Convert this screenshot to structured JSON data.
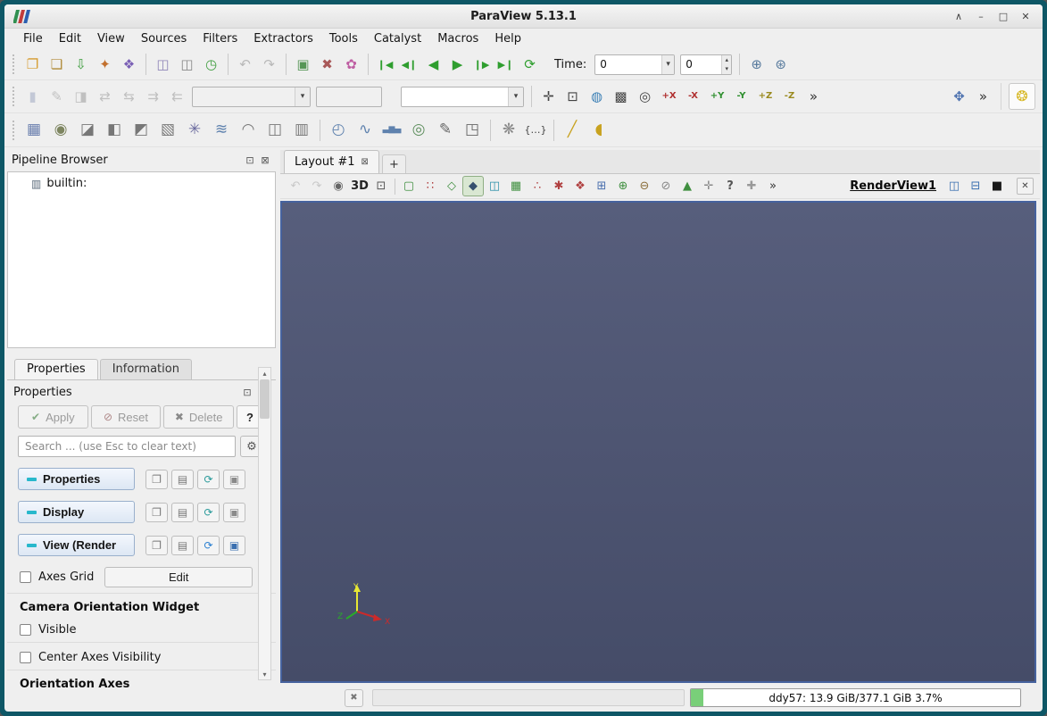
{
  "window": {
    "title": "ParaView 5.13.1",
    "controls": [
      {
        "name": "shade-window-button",
        "glyph": "∧",
        "color": "#444"
      },
      {
        "name": "minimize-window-button",
        "glyph": "–",
        "color": "#444"
      },
      {
        "name": "maximize-window-button",
        "glyph": "□",
        "color": "#444"
      },
      {
        "name": "close-window-button",
        "glyph": "✕",
        "color": "#444"
      }
    ]
  },
  "menu": {
    "items": [
      "File",
      "Edit",
      "View",
      "Sources",
      "Filters",
      "Extractors",
      "Tools",
      "Catalyst",
      "Macros",
      "Help"
    ]
  },
  "toolbar1": {
    "icons": [
      {
        "grip": true
      },
      {
        "name": "open-file-icon",
        "glyph": "❐",
        "color": "#d59b2e"
      },
      {
        "name": "save-state-icon",
        "glyph": "❏",
        "color": "#b08a36"
      },
      {
        "name": "save-data-icon",
        "glyph": "⇩",
        "color": "#3f9e3f"
      },
      {
        "name": "save-screenshot-icon",
        "glyph": "✦",
        "color": "#c2702e"
      },
      {
        "name": "save-animation-icon",
        "glyph": "❖",
        "color": "#7a5fb5"
      },
      {
        "sep": true
      },
      {
        "name": "catalyst-connect-icon",
        "glyph": "◫",
        "color": "#8f86b8"
      },
      {
        "name": "catalyst-export-icon",
        "glyph": "◫",
        "color": "#888888"
      },
      {
        "name": "timer-log-icon",
        "glyph": "◷",
        "color": "#3f9e3f"
      },
      {
        "sep": true
      },
      {
        "name": "undo-icon",
        "glyph": "↶",
        "color": "#777777",
        "disabled": true
      },
      {
        "name": "redo-icon",
        "glyph": "↷",
        "color": "#777777",
        "disabled": true
      },
      {
        "sep": true
      },
      {
        "name": "load-state-icon",
        "glyph": "▣",
        "color": "#579657"
      },
      {
        "name": "reset-session-icon",
        "glyph": "✖",
        "color": "#a85858"
      },
      {
        "name": "color-palette-icon",
        "glyph": "✿",
        "color": "#bf5fa3"
      },
      {
        "sep": true
      },
      {
        "name": "first-frame-button",
        "glyph": "❙◀",
        "color": "#2f9e2f",
        "size": 11
      },
      {
        "name": "previous-frame-button",
        "glyph": "◀❙",
        "color": "#2f9e2f",
        "size": 11
      },
      {
        "name": "play-backward-button",
        "glyph": "◀",
        "color": "#2f9e2f"
      },
      {
        "name": "play-button",
        "glyph": "▶",
        "color": "#2f9e2f"
      },
      {
        "name": "next-frame-button",
        "glyph": "❙▶",
        "color": "#2f9e2f",
        "size": 11
      },
      {
        "name": "last-frame-button",
        "glyph": "▶❙",
        "color": "#2f9e2f",
        "size": 11
      },
      {
        "name": "loop-button",
        "glyph": "⟳",
        "color": "#2f9e2f"
      }
    ],
    "time_label": "Time:",
    "time_value": "0",
    "frame_value": "0",
    "end_icons": [
      {
        "sep": true
      },
      {
        "name": "find-data-icon",
        "glyph": "⊕",
        "color": "#56799c"
      },
      {
        "name": "zoom-to-data-icon",
        "glyph": "⊛",
        "color": "#56799c"
      }
    ]
  },
  "toolbar2": {
    "left_icons": [
      {
        "grip": true
      },
      {
        "name": "toggle-color-legend-icon",
        "glyph": "▮",
        "color": "#8f9ab8",
        "disabled": true
      },
      {
        "name": "edit-color-map-icon",
        "glyph": "✎",
        "color": "#888888",
        "disabled": true
      },
      {
        "name": "separate-color-map-icon",
        "glyph": "◨",
        "color": "#888888",
        "disabled": true
      },
      {
        "name": "rescale-to-data-icon",
        "glyph": "⇄",
        "color": "#888888",
        "disabled": true
      },
      {
        "name": "rescale-custom-range-icon",
        "glyph": "⇆",
        "color": "#888888",
        "disabled": true
      },
      {
        "name": "rescale-temporal-icon",
        "glyph": "⇉",
        "color": "#888888",
        "disabled": true
      },
      {
        "name": "rescale-visible-icon",
        "glyph": "⇇",
        "color": "#888888",
        "disabled": true
      }
    ],
    "array_combo_value": "",
    "component_combo_value": "",
    "representation_combo_value": "",
    "camera_icons": [
      {
        "sep": true
      },
      {
        "name": "reset-camera-icon",
        "glyph": "✛",
        "color": "#444444"
      },
      {
        "name": "zoom-to-data-view-icon",
        "glyph": "⊡",
        "color": "#444444"
      },
      {
        "name": "rubber-band-rotate-icon",
        "glyph": "◍",
        "color": "#3a7fb5"
      },
      {
        "name": "zoom-to-box-icon",
        "glyph": "▩",
        "color": "#444444"
      },
      {
        "name": "reset-camera-closest-icon",
        "glyph": "◎",
        "color": "#444444"
      },
      {
        "name": "set-view-plus-x-button",
        "glyph": "+X",
        "text": true,
        "color": "#b03030"
      },
      {
        "name": "set-view-minus-x-button",
        "glyph": "-X",
        "text": true,
        "color": "#b03030"
      },
      {
        "name": "set-view-plus-y-button",
        "glyph": "+Y",
        "text": true,
        "color": "#2f8f2f"
      },
      {
        "name": "set-view-minus-y-button",
        "glyph": "-Y",
        "text": true,
        "color": "#2f8f2f"
      },
      {
        "name": "set-view-plus-z-button",
        "glyph": "+Z",
        "text": true,
        "color": "#9a8a1f"
      },
      {
        "name": "set-view-minus-z-button",
        "glyph": "-Z",
        "text": true,
        "color": "#9a8a1f"
      },
      {
        "name": "camera-overflow-chevron",
        "glyph": "»",
        "color": "#333333"
      }
    ],
    "right_icons": [
      {
        "name": "adjust-camera-icon",
        "glyph": "✥",
        "color": "#4a6fae"
      },
      {
        "name": "camera-widget-overflow-chevron",
        "glyph": "»",
        "color": "#333333"
      }
    ],
    "light_icons": [
      {
        "name": "light-kit-icon",
        "glyph": "❂",
        "color": "#d7b722"
      }
    ]
  },
  "toolbar3": {
    "icons": [
      {
        "grip": true
      },
      {
        "name": "calculator-icon",
        "glyph": "▦",
        "color": "#6a7fae"
      },
      {
        "name": "contour-icon",
        "glyph": "◉",
        "color": "#7d8560"
      },
      {
        "name": "clip-icon",
        "glyph": "◪",
        "color": "#777777"
      },
      {
        "name": "slice-icon",
        "glyph": "◧",
        "color": "#777777"
      },
      {
        "name": "threshold-icon",
        "glyph": "◩",
        "color": "#777777"
      },
      {
        "name": "extract-subset-icon",
        "glyph": "▧",
        "color": "#777777"
      },
      {
        "name": "glyph-filter-icon",
        "glyph": "✳",
        "color": "#6a6a9e"
      },
      {
        "name": "stream-tracer-icon",
        "glyph": "≋",
        "color": "#5f82ae"
      },
      {
        "name": "warp-by-vector-icon",
        "glyph": "◠",
        "color": "#777777"
      },
      {
        "name": "group-datasets-icon",
        "glyph": "◫",
        "color": "#777777"
      },
      {
        "name": "extract-group-icon",
        "glyph": "▥",
        "color": "#777777"
      },
      {
        "sep": true
      },
      {
        "name": "extract-time-icon",
        "glyph": "◴",
        "color": "#5f82ae"
      },
      {
        "name": "plot-over-line-icon",
        "glyph": "∿",
        "color": "#5f82ae"
      },
      {
        "name": "histogram-icon",
        "glyph": "▃▆▄",
        "color": "#5f82ae",
        "size": 9
      },
      {
        "name": "probe-location-icon",
        "glyph": "◎",
        "color": "#5f8f5f"
      },
      {
        "name": "plot-selection-icon",
        "glyph": "✎",
        "color": "#666666"
      },
      {
        "name": "extract-selection-icon",
        "glyph": "◳",
        "color": "#666666"
      },
      {
        "sep": true
      },
      {
        "name": "temporal-interpolator-icon",
        "glyph": "❋",
        "color": "#888888"
      },
      {
        "name": "python-annotation-icon",
        "glyph": "{…}",
        "color": "#444444",
        "size": 11
      },
      {
        "sep": true
      },
      {
        "name": "ruler-icon",
        "glyph": "╱",
        "color": "#c8a21f"
      },
      {
        "name": "protractor-icon",
        "glyph": "◖",
        "color": "#c8a21f"
      }
    ]
  },
  "pipeline": {
    "title": "Pipeline Browser",
    "header_icons": [
      {
        "name": "undock-panel-icon",
        "glyph": "⊡",
        "color": "#555555"
      },
      {
        "name": "close-panel-icon",
        "glyph": "⊠",
        "color": "#555555"
      }
    ],
    "items": [
      {
        "glyph": "▥",
        "label": "builtin:"
      }
    ]
  },
  "tabs": {
    "properties": "Properties",
    "information": "Information"
  },
  "props": {
    "title": "Properties",
    "header_icons": [
      {
        "name": "undock-panel-icon",
        "glyph": "⊡",
        "color": "#555555"
      },
      {
        "name": "close-panel-icon",
        "glyph": "⊠",
        "color": "#555555"
      }
    ],
    "apply_label": "Apply",
    "apply_glyph": "✔",
    "reset_label": "Reset",
    "reset_glyph": "⊘",
    "delete_label": "Delete",
    "delete_glyph": "✖",
    "help_label": "?",
    "search_placeholder": "Search ... (use Esc to clear text)",
    "search_gear": "⚙",
    "sections": [
      {
        "label": "Properties",
        "icons": [
          {
            "name": "copy-properties-icon",
            "glyph": "❐",
            "color": "#777777"
          },
          {
            "name": "paste-properties-icon",
            "glyph": "▤",
            "color": "#777777"
          },
          {
            "name": "restore-defaults-icon",
            "glyph": "⟳",
            "color": "#2a9a9a"
          },
          {
            "name": "save-defaults-icon",
            "glyph": "▣",
            "color": "#8a8a8a"
          }
        ]
      },
      {
        "label": "Display",
        "icons": [
          {
            "name": "copy-display-icon",
            "glyph": "❐",
            "color": "#777777"
          },
          {
            "name": "paste-display-icon",
            "glyph": "▤",
            "color": "#777777"
          },
          {
            "name": "restore-display-defaults-icon",
            "glyph": "⟳",
            "color": "#2a9a9a"
          },
          {
            "name": "save-display-defaults-icon",
            "glyph": "▣",
            "color": "#8a8a8a"
          }
        ]
      },
      {
        "label": "View (Render",
        "icons": [
          {
            "name": "copy-view-icon",
            "glyph": "❐",
            "color": "#777777"
          },
          {
            "name": "paste-view-icon",
            "glyph": "▤",
            "color": "#777777"
          },
          {
            "name": "restore-view-defaults-icon",
            "glyph": "⟳",
            "color": "#2a7fd0"
          },
          {
            "name": "save-view-defaults-icon",
            "glyph": "▣",
            "color": "#3a6fb0"
          }
        ]
      }
    ],
    "axes_grid_label": "Axes Grid",
    "edit_label": "Edit",
    "camera_widget_label": "Camera Orientation Widget",
    "visible_label": "Visible",
    "center_axes_label": "Center Axes Visibility",
    "orientation_axes_label": "Orientation Axes"
  },
  "layout": {
    "tab_label": "Layout #1",
    "tab_close": "⊠",
    "new_tab": "+"
  },
  "render": {
    "icons": [
      {
        "name": "camera-undo-icon",
        "glyph": "↶",
        "color": "#999999",
        "disabled": true
      },
      {
        "name": "camera-redo-icon",
        "glyph": "↷",
        "color": "#999999",
        "disabled": true
      },
      {
        "name": "capture-view-icon",
        "glyph": "◉",
        "color": "#666666"
      },
      {
        "name": "toggle-2d-3d-button",
        "glyph": "3D",
        "text": true,
        "color": "#222222"
      },
      {
        "name": "zoom-box-icon",
        "glyph": "⊡",
        "color": "#555555"
      },
      {
        "sep": true
      },
      {
        "name": "select-cells-rect-icon",
        "glyph": "▢",
        "color": "#3f8f3f"
      },
      {
        "name": "select-points-rect-icon",
        "glyph": "∷",
        "color": "#b04040"
      },
      {
        "name": "select-cells-polygon-icon",
        "glyph": "◇",
        "color": "#3f8f3f"
      },
      {
        "name": "select-points-polygon-icon",
        "glyph": "◆",
        "color": "#35506e",
        "active": true
      },
      {
        "name": "select-block-icon",
        "glyph": "◫",
        "color": "#2a8fa8"
      },
      {
        "name": "select-frustum-cells-icon",
        "glyph": "▦",
        "color": "#3f8f3f"
      },
      {
        "name": "interactive-select-cells-icon",
        "glyph": "∴",
        "color": "#b04040"
      },
      {
        "name": "interactive-select-points-icon",
        "glyph": "✱",
        "color": "#b04040"
      },
      {
        "name": "hover-points-icon",
        "glyph": "❖",
        "color": "#b04040"
      },
      {
        "name": "hover-cells-icon",
        "glyph": "⊞",
        "color": "#4a6fae"
      },
      {
        "name": "grow-selection-icon",
        "glyph": "⊕",
        "color": "#3f8f3f"
      },
      {
        "name": "shrink-selection-icon",
        "glyph": "⊖",
        "color": "#8a6d3a"
      },
      {
        "name": "clear-selection-icon",
        "glyph": "⊘",
        "color": "#888888"
      },
      {
        "name": "tooltip-selection-icon",
        "glyph": "▲",
        "color": "#3f8f3f"
      },
      {
        "name": "pick-center-icon",
        "glyph": "✛",
        "color": "#888888"
      },
      {
        "name": "selection-help-icon",
        "glyph": "?",
        "text": true,
        "color": "#555555"
      },
      {
        "name": "add-text-annotation-icon",
        "glyph": "✚",
        "color": "#999999"
      },
      {
        "name": "render-overflow-chevron",
        "glyph": "»",
        "color": "#333333"
      }
    ],
    "view_name": "RenderView1",
    "right_icons": [
      {
        "name": "split-horizontal-icon",
        "glyph": "◫",
        "color": "#3a6fb0"
      },
      {
        "name": "split-vertical-icon",
        "glyph": "⊟",
        "color": "#3a6fb0"
      },
      {
        "name": "maximize-view-icon",
        "glyph": "■",
        "color": "#1a1a1a"
      }
    ],
    "close_glyph": "✕"
  },
  "viewport": {
    "bg": "#4d5470",
    "axes": {
      "x": "X",
      "y": "Y",
      "z": "Z"
    }
  },
  "statusbar": {
    "abort_glyph": "✖",
    "memory": "ddy57: 13.9 GiB/377.1 GiB 3.7%",
    "memory_pct": 3.7
  },
  "icons": {
    "dropdown": "▾",
    "spin_up": "▴",
    "spin_down": "▾",
    "scroll_up": "▴",
    "scroll_down": "▾"
  }
}
